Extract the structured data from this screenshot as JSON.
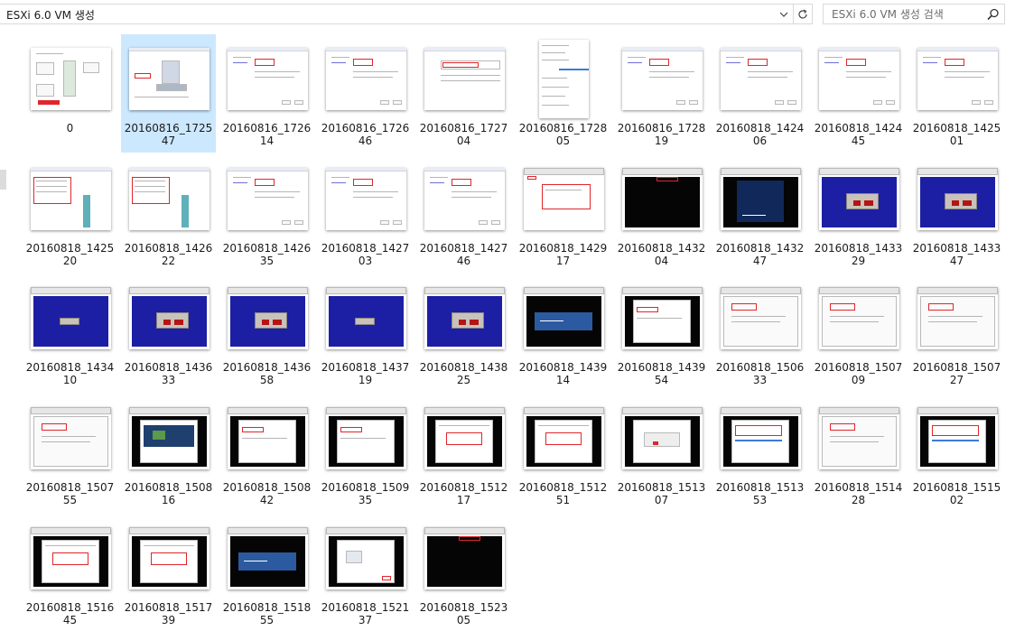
{
  "address_bar": {
    "path": "ESXi 6.0 VM 생성"
  },
  "search": {
    "placeholder": "ESXi 6.0 VM 생성 검색"
  },
  "icons": {
    "dropdown": "chevron-down-icon",
    "refresh": "refresh-icon",
    "search": "search-icon"
  },
  "colors": {
    "selection": "#cce8ff",
    "annotation_red": "#e0262b",
    "installer_blue": "#1c1fa3"
  },
  "files": [
    {
      "name": "0",
      "kind": "diagram"
    },
    {
      "name": "20160816_172547",
      "kind": "wizard-icon",
      "selected": true
    },
    {
      "name": "20160816_172614",
      "kind": "dialog"
    },
    {
      "name": "20160816_172646",
      "kind": "dialog"
    },
    {
      "name": "20160816_172704",
      "kind": "table"
    },
    {
      "name": "20160816_172805",
      "kind": "list"
    },
    {
      "name": "20160816_172819",
      "kind": "dialog"
    },
    {
      "name": "20160818_142406",
      "kind": "dialog"
    },
    {
      "name": "20160818_142445",
      "kind": "dialog"
    },
    {
      "name": "20160818_142501",
      "kind": "dialog"
    },
    {
      "name": "20160818_142520",
      "kind": "tree"
    },
    {
      "name": "20160818_142622",
      "kind": "tree"
    },
    {
      "name": "20160818_142635",
      "kind": "dialog"
    },
    {
      "name": "20160818_142703",
      "kind": "dialog"
    },
    {
      "name": "20160818_142746",
      "kind": "dialog"
    },
    {
      "name": "20160818_142917",
      "kind": "console-white"
    },
    {
      "name": "20160818_143204",
      "kind": "console-black"
    },
    {
      "name": "20160818_143247",
      "kind": "centos-boot"
    },
    {
      "name": "20160818_143329",
      "kind": "blue-dialog"
    },
    {
      "name": "20160818_143347",
      "kind": "blue-dialog"
    },
    {
      "name": "20160818_143410",
      "kind": "blue-small"
    },
    {
      "name": "20160818_143633",
      "kind": "blue-dialog"
    },
    {
      "name": "20160818_143658",
      "kind": "blue-dialog"
    },
    {
      "name": "20160818_143719",
      "kind": "blue-small"
    },
    {
      "name": "20160818_143825",
      "kind": "blue-dialog"
    },
    {
      "name": "20160818_143914",
      "kind": "centos-splash"
    },
    {
      "name": "20160818_143954",
      "kind": "installer"
    },
    {
      "name": "20160818_150633",
      "kind": "installer-light"
    },
    {
      "name": "20160818_150709",
      "kind": "installer-light"
    },
    {
      "name": "20160818_150727",
      "kind": "installer-light"
    },
    {
      "name": "20160818_150755",
      "kind": "installer-light"
    },
    {
      "name": "20160818_150816",
      "kind": "installer-map"
    },
    {
      "name": "20160818_150842",
      "kind": "installer"
    },
    {
      "name": "20160818_150935",
      "kind": "installer"
    },
    {
      "name": "20160818_151217",
      "kind": "installer-table"
    },
    {
      "name": "20160818_151251",
      "kind": "installer-table"
    },
    {
      "name": "20160818_151307",
      "kind": "installer-dialog"
    },
    {
      "name": "20160818_151353",
      "kind": "installer-form"
    },
    {
      "name": "20160818_151428",
      "kind": "installer-light"
    },
    {
      "name": "20160818_151502",
      "kind": "installer-form"
    },
    {
      "name": "20160818_151645",
      "kind": "installer-table"
    },
    {
      "name": "20160818_151739",
      "kind": "installer-table"
    },
    {
      "name": "20160818_151855",
      "kind": "centos-splash"
    },
    {
      "name": "20160818_152137",
      "kind": "installer-finish"
    },
    {
      "name": "20160818_152305",
      "kind": "console-black"
    }
  ]
}
